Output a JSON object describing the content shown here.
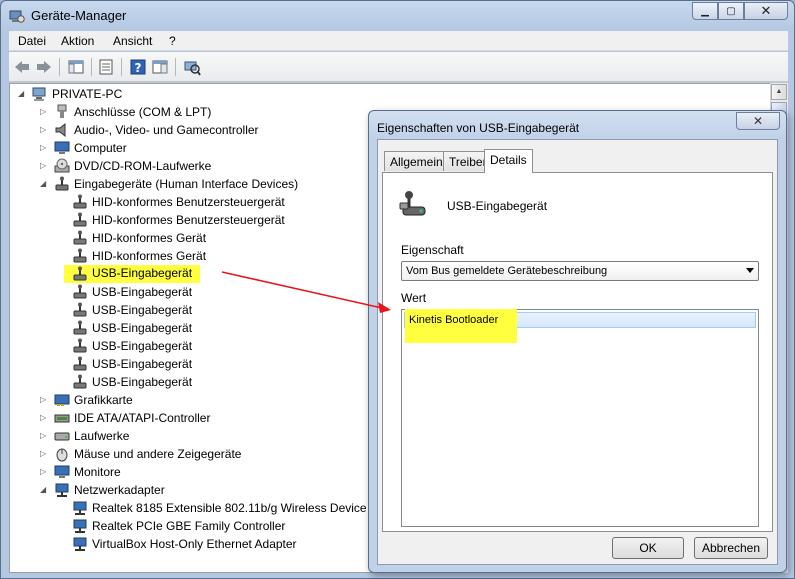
{
  "window": {
    "title": "Geräte-Manager"
  },
  "menu": [
    "Datei",
    "Aktion",
    "Ansicht",
    "?"
  ],
  "tree": {
    "root": "PRIVATE-PC",
    "categories": [
      "Anschlüsse (COM & LPT)",
      "Audio-, Video- und Gamecontroller",
      "Computer",
      "DVD/CD-ROM-Laufwerke",
      "Eingabegeräte (Human Interface Devices)",
      "Grafikkarte",
      "IDE ATA/ATAPI-Controller",
      "Laufwerke",
      "Mäuse und andere Zeigegeräte",
      "Monitore",
      "Netzwerkadapter"
    ],
    "hid_children": [
      "HID-konformes Benutzersteuergerät",
      "HID-konformes Benutzersteuergerät",
      "HID-konformes Gerät",
      "HID-konformes Gerät",
      "USB-Eingabegerät",
      "USB-Eingabegerät",
      "USB-Eingabegerät",
      "USB-Eingabegerät",
      "USB-Eingabegerät",
      "USB-Eingabegerät",
      "USB-Eingabegerät"
    ],
    "net_children": [
      "Realtek 8185 Extensible 802.11b/g Wireless Device",
      "Realtek PCIe GBE Family Controller",
      "VirtualBox Host-Only Ethernet Adapter"
    ]
  },
  "dialog": {
    "title": "Eigenschaften von USB-Eingabegerät",
    "tabs": [
      "Allgemein",
      "Treiber",
      "Details"
    ],
    "device_name": "USB-Eingabegerät",
    "property_label": "Eigenschaft",
    "property_value": "Vom Bus gemeldete Gerätebeschreibung",
    "value_label": "Wert",
    "value": "Kinetis Bootloader",
    "ok": "OK",
    "cancel": "Abbrechen"
  },
  "colors": {
    "highlight": "#ffff40",
    "arrow": "#e8141e"
  }
}
